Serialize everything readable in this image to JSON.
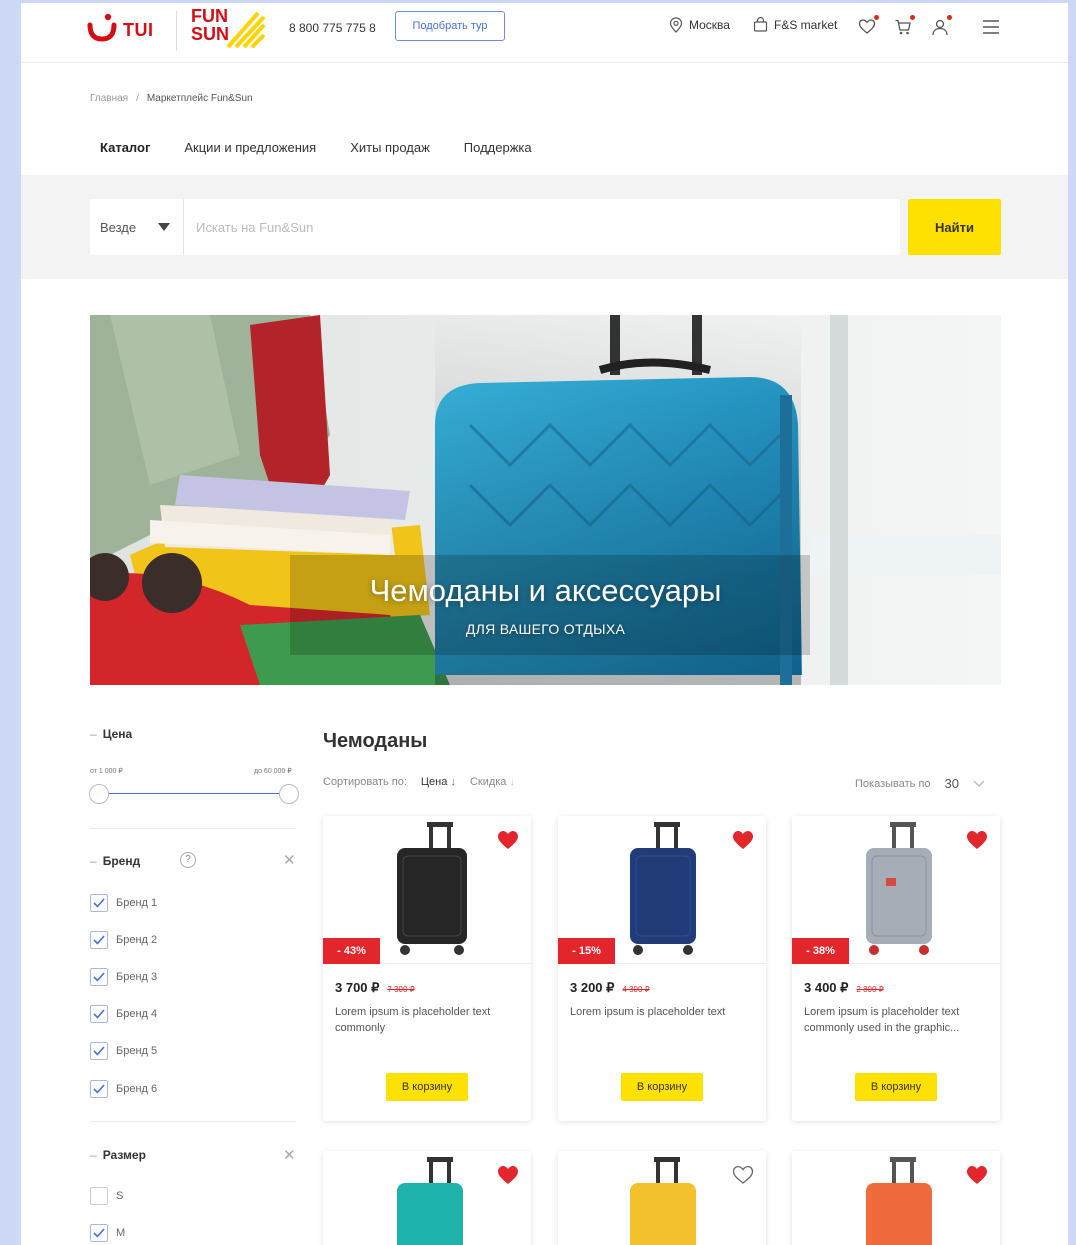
{
  "header": {
    "brand_tui": "TUI",
    "brand_fun_top": "FUN",
    "brand_fun_bottom": "SUN",
    "phone": "8 800 775 775 8",
    "pick_tour": "Подобрать тур",
    "city": "Москва",
    "market": "F&S market",
    "icons": [
      "location-icon",
      "bag-icon",
      "heart-icon",
      "cart-icon",
      "user-icon",
      "menu-icon"
    ]
  },
  "breadcrumb": {
    "items": [
      "Главная",
      "Маркетплейс Fun&Sun"
    ],
    "separator": "/"
  },
  "tabs": [
    {
      "label": "Каталог",
      "active": true
    },
    {
      "label": "Акции и предложения",
      "active": false
    },
    {
      "label": "Хиты продаж",
      "active": false
    },
    {
      "label": "Поддержка",
      "active": false
    }
  ],
  "search": {
    "scope": "Везде",
    "placeholder": "Искать на Fun&Sun",
    "button": "Найти"
  },
  "banner": {
    "title": "Чемоданы и аксессуары",
    "subtitle": "ДЛЯ ВАШЕГО ОТДЫХА"
  },
  "filters": {
    "price": {
      "title": "Цена",
      "from": "от 1 000 ₽",
      "to": "до 60 000 ₽"
    },
    "brand": {
      "title": "Бренд",
      "help": "?",
      "items": [
        {
          "label": "Бренд 1",
          "checked": true
        },
        {
          "label": "Бренд 2",
          "checked": true
        },
        {
          "label": "Бренд 3",
          "checked": true
        },
        {
          "label": "Бренд 4",
          "checked": true
        },
        {
          "label": "Бренд 5",
          "checked": true
        },
        {
          "label": "Бренд 6",
          "checked": true
        }
      ]
    },
    "size": {
      "title": "Размер",
      "items": [
        {
          "label": "S",
          "checked": false
        },
        {
          "label": "M",
          "checked": true
        }
      ]
    }
  },
  "catalog": {
    "title": "Чемоданы",
    "sort_label": "Сортировать по:",
    "sort_price": "Цена",
    "sort_discount": "Скидка",
    "show_by_label": "Показывать по",
    "show_by_value": "30",
    "cart_label": "В корзину",
    "products": [
      {
        "price": "3 700 ₽",
        "old_price": "7 300 ₽",
        "discount": "- 43%",
        "desc": "Lorem ipsum is placeholder text commonly",
        "color": "#262626",
        "favorite": true
      },
      {
        "price": "3 200 ₽",
        "old_price": "4 300 ₽",
        "discount": "- 15%",
        "desc": "Lorem ipsum is placeholder text",
        "color": "#213c78",
        "favorite": true
      },
      {
        "price": "3 400 ₽",
        "old_price": "2 800 ₽",
        "discount": "- 38%",
        "desc": "Lorem ipsum is placeholder text commonly used in the graphic...",
        "color": "#a7adb6",
        "favorite": true
      },
      {
        "color": "#1fb3ad",
        "favorite": true
      },
      {
        "color": "#f2c12c",
        "favorite": false
      },
      {
        "color": "#ef6a3c",
        "favorite": true
      }
    ]
  },
  "colors": {
    "brand_red": "#d40e14",
    "accent_yellow": "#ffe100",
    "accent_blue": "#4a70d4",
    "discount_red": "#e2262b"
  }
}
